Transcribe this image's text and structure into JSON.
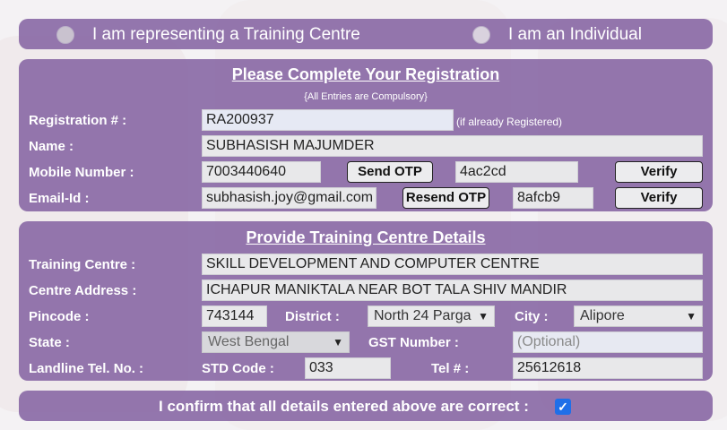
{
  "mode": {
    "option_training_centre": "I am representing a Training Centre",
    "option_individual": "I am an Individual"
  },
  "registration": {
    "title": "Please Complete Your Registration",
    "subtitle": "{All Entries are Compulsory}",
    "reg_label": "Registration # :",
    "reg_value": "RA200937",
    "reg_note": "(if already Registered)",
    "name_label": "Name :",
    "name_value": "SUBHASISH MAJUMDER",
    "mobile_label": "Mobile Number :",
    "mobile_value": "7003440640",
    "send_otp": "Send OTP",
    "mobile_otp_value": "4ac2cd",
    "verify_label": "Verify",
    "email_label": "Email-Id :",
    "email_value": "subhasish.joy@gmail.com",
    "resend_otp": "Resend OTP",
    "email_otp_value": "8afcb9"
  },
  "training_centre": {
    "title": "Provide Training Centre Details",
    "centre_label": "Training Centre :",
    "centre_value": "SKILL DEVELOPMENT AND COMPUTER CENTRE",
    "address_label": "Centre Address :",
    "address_value": "ICHAPUR MANIKTALA NEAR BOT TALA SHIV MANDIR",
    "pincode_label": "Pincode :",
    "pincode_value": "743144",
    "district_label": "District :",
    "district_value": "North 24 Parga",
    "city_label": "City :",
    "city_value": "Alipore",
    "state_label": "State :",
    "state_value": "West Bengal",
    "gst_label": "GST Number :",
    "gst_placeholder": "(Optional)",
    "landline_label": "Landline Tel. No. :",
    "std_label": "STD Code :",
    "std_value": "033",
    "tel_label": "Tel # :",
    "tel_value": "25612618"
  },
  "confirm": {
    "text": "I confirm that all details entered above are correct :",
    "checked": true
  },
  "colors": {
    "panel": "#8564a3",
    "checkbox": "#1f6fe8"
  }
}
